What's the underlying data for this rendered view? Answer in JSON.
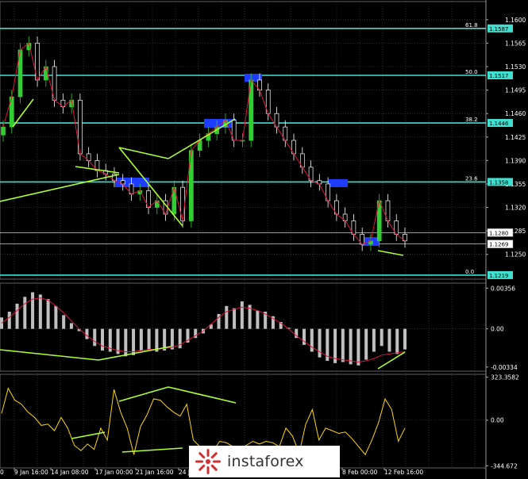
{
  "chart_data": [
    {
      "type": "line",
      "panel": "price",
      "y_ticks": [
        "1.1600",
        "1.1565",
        "1.1530",
        "1.1495",
        "1.1460",
        "1.1425",
        "1.1390",
        "1.1355",
        "1.1320",
        "1.1285",
        "1.1250"
      ],
      "ylim": [
        1.1213,
        1.1627
      ],
      "x_ticks": [
        "9 Jan 16:00",
        "14 Jan 08:00",
        "17 Jan 00:00",
        "21 Jan 16:00",
        "24 Jan",
        "8 Feb 00:00",
        "12 Feb 16:00"
      ],
      "x_left_partial": "0",
      "fib_levels": [
        {
          "ratio": "61.8",
          "price": "1.1587",
          "value": 1.1587
        },
        {
          "ratio": "50.0",
          "price": "1.1517",
          "value": 1.1517
        },
        {
          "ratio": "38.2",
          "price": "1.1446",
          "value": 1.1446
        },
        {
          "ratio": "23.6",
          "price": "1.1358",
          "value": 1.1358
        },
        {
          "ratio": "0.0",
          "price": "1.1219",
          "value": 1.1219
        }
      ],
      "current_price_tags": [
        {
          "label": "1.1280",
          "value": 1.128
        },
        {
          "label": "1.1269",
          "value": 1.1269
        }
      ],
      "series": [
        {
          "values": [
            1.144,
            1.1485,
            1.1555,
            1.1565,
            1.151,
            1.153,
            1.148,
            1.147,
            1.148,
            1.14,
            1.139,
            1.1375,
            1.137,
            1.136,
            1.1355,
            1.134,
            1.1345,
            1.132,
            1.133,
            1.131,
            1.135,
            1.13,
            1.1405,
            1.142,
            1.143,
            1.144,
            1.145,
            1.142,
            1.142,
            1.151,
            1.1495,
            1.146,
            1.144,
            1.142,
            1.14,
            1.138,
            1.136,
            1.1355,
            1.133,
            1.131,
            1.13,
            1.128,
            1.1265,
            1.127,
            1.133,
            1.13,
            1.128,
            1.127
          ]
        }
      ]
    },
    {
      "type": "bar",
      "panel": "macd",
      "y_ticks": [
        "0.00356",
        "0.00",
        "-0.00334"
      ],
      "ylim": [
        -0.0037,
        0.004
      ],
      "series": [
        {
          "values": [
            0.001,
            0.0015,
            0.0022,
            0.0028,
            0.0032,
            0.003,
            0.0026,
            0.002,
            0.0012,
            0.0005,
            -0.0002,
            -0.0009,
            -0.0015,
            -0.0019,
            -0.002,
            -0.0022,
            -0.0024,
            -0.0023,
            -0.0019,
            -0.0018,
            -0.002,
            -0.0019,
            -0.0018,
            -0.0017,
            -0.0012,
            -0.0008,
            -0.0004,
            0.0004,
            0.0013,
            0.002,
            0.0018,
            0.0024,
            0.0021,
            0.0016,
            0.0015,
            0.0011,
            0.0006,
            0.0001,
            -0.0008,
            -0.0014,
            -0.002,
            -0.0025,
            -0.0028,
            -0.003,
            -0.0029,
            -0.0031,
            -0.0032,
            -0.0027,
            -0.002,
            -0.0015,
            -0.002,
            -0.0022,
            -0.0018
          ]
        },
        {
          "values": [
            0.0005,
            0.001,
            0.0016,
            0.0022,
            0.0026,
            0.0027,
            0.0025,
            0.002,
            0.0014,
            0.0007,
            0.0,
            -0.0006,
            -0.0011,
            -0.0015,
            -0.0017,
            -0.0019,
            -0.002,
            -0.002,
            -0.0019,
            -0.0018,
            -0.0018,
            -0.0017,
            -0.0016,
            -0.0014,
            -0.001,
            -0.0006,
            -0.0002,
            0.0004,
            0.001,
            0.0015,
            0.0017,
            0.0019,
            0.0018,
            0.0016,
            0.0013,
            0.0009,
            0.0005,
            0.0,
            -0.0006,
            -0.0011,
            -0.0016,
            -0.002,
            -0.0024,
            -0.0026,
            -0.0027,
            -0.0028,
            -0.0029,
            -0.0028,
            -0.0026,
            -0.0023,
            -0.0022,
            -0.0021,
            -0.002
          ]
        }
      ]
    },
    {
      "type": "line",
      "panel": "cci",
      "y_ticks": [
        "323.3582",
        "0.00",
        "-344.672"
      ],
      "ylim": [
        -360,
        345
      ],
      "series": [
        {
          "values": [
            50,
            240,
            150,
            120,
            60,
            20,
            -40,
            -30,
            -80,
            20,
            -60,
            -190,
            -230,
            -180,
            -220,
            -60,
            -150,
            230,
            60,
            -60,
            -260,
            -50,
            40,
            160,
            150,
            100,
            60,
            30,
            120,
            -150,
            -200,
            -220,
            -230,
            -160,
            -170,
            -200,
            -230,
            -190,
            -160,
            -180,
            -160,
            -170,
            -200,
            -60,
            -120,
            -250,
            -30,
            80,
            -150,
            -60,
            -80,
            -100,
            -90,
            -140,
            -200,
            -260,
            -150,
            -20,
            160,
            80,
            -160,
            -60
          ]
        }
      ]
    }
  ],
  "watermark": {
    "brand": "instaforex"
  },
  "colors": {
    "background": "#000000",
    "grid": "#465046",
    "fib_line": "#40e0d0",
    "bull_candle": "#32cd32",
    "bear_candle": "#ffffff",
    "zigzag": "#dc143c",
    "trendline": "#adff2f",
    "zone": "#1e3cff",
    "macd_hist": "#c0c0c0",
    "macd_signal": "#dc143c",
    "cci_line": "#ffd700"
  }
}
